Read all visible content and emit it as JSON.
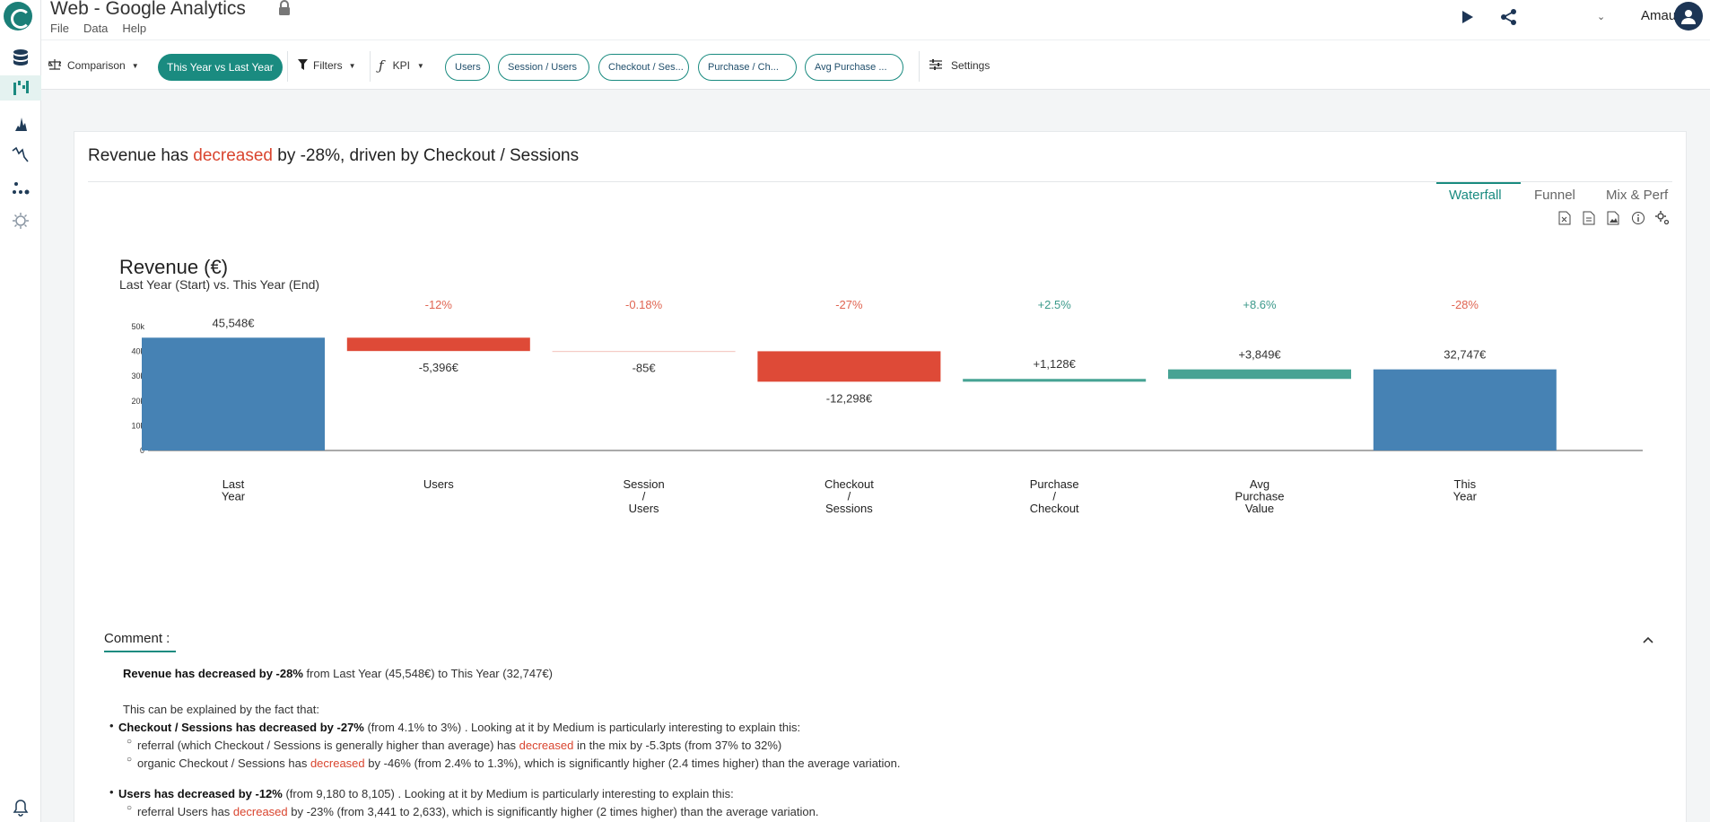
{
  "app": {
    "title": "Web - Google Analytics"
  },
  "menu": [
    "File",
    "Data",
    "Help"
  ],
  "user": {
    "name": "Amaury"
  },
  "toolbar": {
    "comparison": "Comparison",
    "period": "This Year vs Last Year",
    "filters": "Filters",
    "kpi": "KPI",
    "kpi_pills": [
      "Users",
      "Session / Users",
      "Checkout / Ses...",
      "Purchase / Ch...",
      "Avg Purchase ..."
    ],
    "settings": "Settings"
  },
  "headline": {
    "pre": "Revenue has ",
    "verb": "decreased",
    "post": " by -28%, driven by Checkout / Sessions"
  },
  "tabs": [
    "Waterfall",
    "Funnel",
    "Mix & Perf"
  ],
  "chart_data": {
    "type": "waterfall",
    "title": "Revenue (€)",
    "subtitle": "Last Year (Start) vs. This Year (End)",
    "y_ticks": [
      "0",
      "10k",
      "20k",
      "30k",
      "40k",
      "50k"
    ],
    "ylim": [
      0,
      50000
    ],
    "categories": [
      [
        "Last",
        "Year"
      ],
      [
        "Users"
      ],
      [
        "Session",
        "/",
        "Users"
      ],
      [
        "Checkout",
        "/",
        "Sessions"
      ],
      [
        "Purchase",
        "/",
        "Checkout"
      ],
      [
        "Avg",
        "Purchase",
        "Value"
      ],
      [
        "This",
        "Year"
      ]
    ],
    "kinds": [
      "total",
      "delta",
      "delta",
      "delta",
      "delta",
      "delta",
      "total"
    ],
    "values": [
      45548,
      -5396,
      -85,
      -12298,
      1128,
      3849,
      32747
    ],
    "value_labels": [
      "45,548€",
      "-5,396€",
      "-85€",
      "-12,298€",
      "+1,128€",
      "+3,849€",
      "32,747€"
    ],
    "pct_labels": [
      "",
      "-12%",
      "-0.18%",
      "-27%",
      "+2.5%",
      "+8.6%",
      "-28%"
    ],
    "colors": {
      "total": "#4682b4",
      "decrease": "#de4a37",
      "increase": "#47a394",
      "neg_text": "#e06552",
      "pos_text": "#3c9a8b"
    }
  },
  "comment": {
    "label": "Comment :",
    "summary": {
      "a": "Revenue has ",
      "b": "decreased",
      "c": " by -28%",
      "d": " from Last Year (45,548€) to This Year (32,747€)"
    },
    "intro": "This can be explained by the fact that:",
    "b1": {
      "a": "Checkout / Sessions has ",
      "b": "decreased",
      "c": " by -27%",
      "d": " (from 4.1% to 3%) . Looking at it by Medium is particularly interesting to explain this:"
    },
    "b1s1": {
      "a": "referral (which Checkout / Sessions is generally higher than average) has ",
      "b": "decreased",
      "c": " in the mix by -5.3pts (from 37% to 32%)"
    },
    "b1s2": {
      "a": "organic Checkout / Sessions has ",
      "b": "decreased",
      "c": " by -46% (from 2.4% to 1.3%), which is significantly higher (2.4 times higher) than the average variation."
    },
    "b2": {
      "a": "Users has ",
      "b": "decreased",
      "c": " by -12%",
      "d": " (from 9,180 to 8,105) . Looking at it by Medium is particularly interesting to explain this:"
    },
    "b2s1": {
      "a": "referral Users has ",
      "b": "decreased",
      "c": " by -23% (from 3,441 to 2,633), which is significantly higher (2 times higher) than the average variation."
    }
  }
}
